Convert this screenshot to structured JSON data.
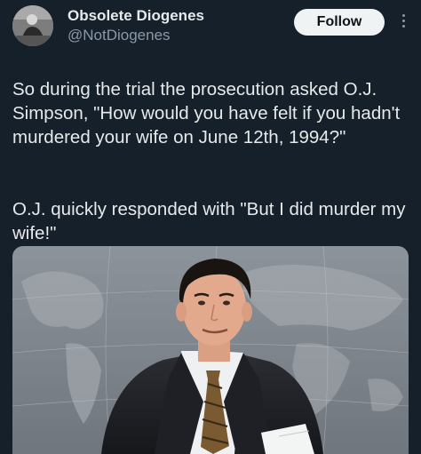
{
  "tweet": {
    "author": {
      "display_name": "Obsolete Diogenes",
      "handle": "@NotDiogenes",
      "avatar_icon": "avatar-photo"
    },
    "follow_label": "Follow",
    "more_icon": "more-vertical-icon",
    "paragraphs": [
      "So during the trial the prosecution asked O.J. Simpson, \"How would you have felt if you hadn't murdered your wife on June 12th, 1994?\"",
      "O.J. quickly responded with \"But I did murder my wife!\""
    ],
    "media_icon": "news-anchor-photo"
  },
  "colors": {
    "background": "#15202b",
    "text": "#e7e9ea",
    "secondary_text": "#8b98a5",
    "button_bg": "#eff3f4"
  }
}
